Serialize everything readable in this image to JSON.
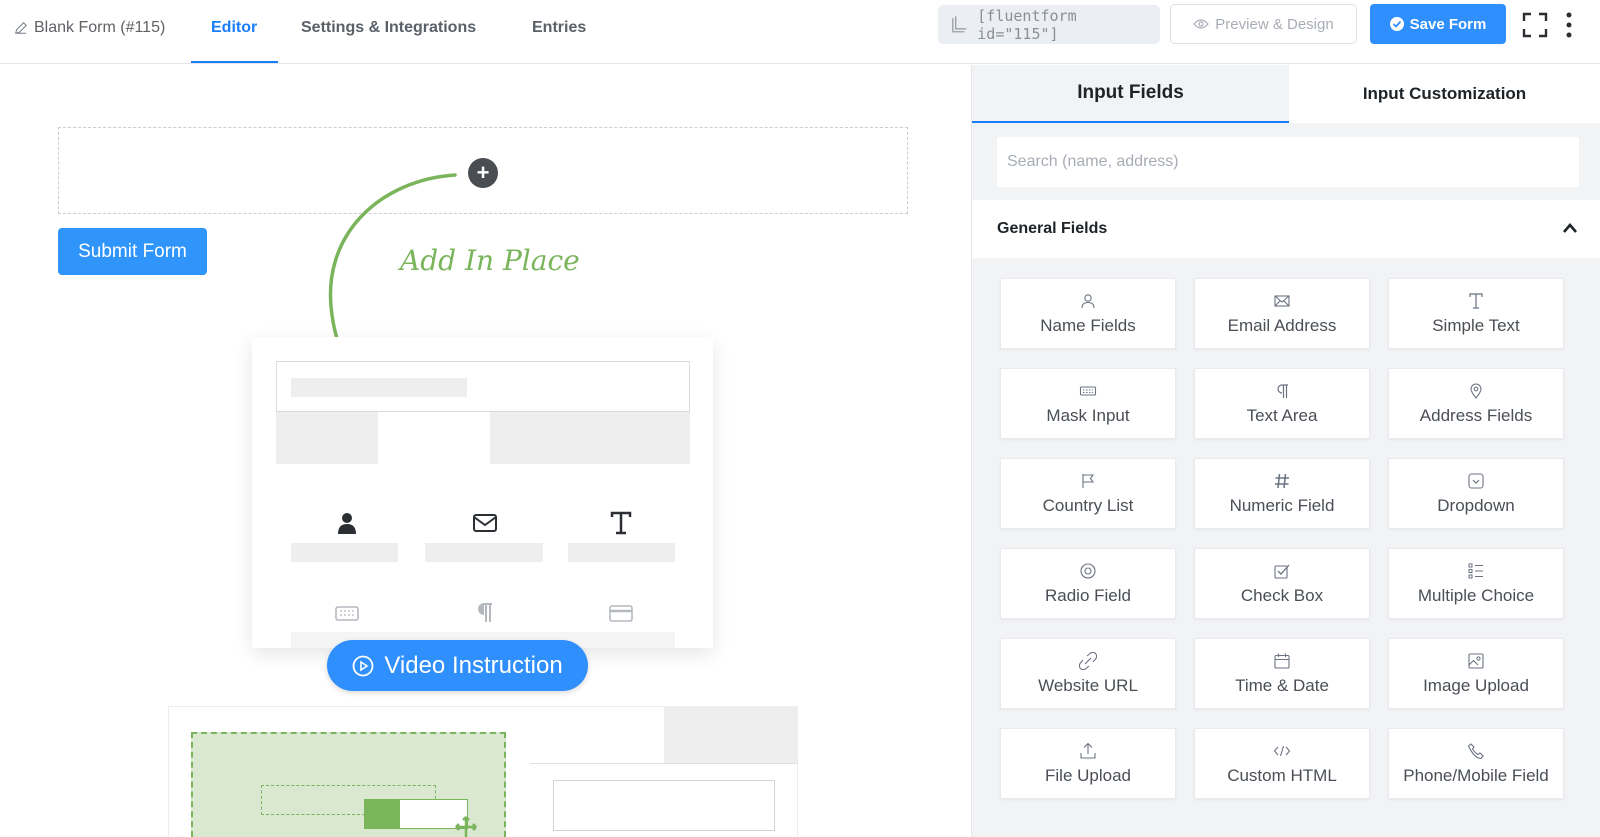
{
  "header": {
    "form_title": "Blank Form (#115)",
    "tabs": [
      {
        "label": "Editor",
        "active": true
      },
      {
        "label": "Settings & Integrations",
        "active": false
      },
      {
        "label": "Entries",
        "active": false
      }
    ],
    "shortcode": "[fluentform id=\"115\"]",
    "preview_label": "Preview & Design",
    "save_label": "Save Form",
    "accent_color": "#1a7efb"
  },
  "canvas": {
    "submit_label": "Submit Form",
    "add_in_place_label": "Add In Place",
    "video_label": "Video Instruction"
  },
  "panel": {
    "tabs": [
      {
        "label": "Input Fields",
        "active": true
      },
      {
        "label": "Input Customization",
        "active": false
      }
    ],
    "search_placeholder": "Search (name, address)",
    "section_title": "General Fields",
    "fields": [
      {
        "label": "Name Fields",
        "icon": "user-icon"
      },
      {
        "label": "Email Address",
        "icon": "envelope-icon"
      },
      {
        "label": "Simple Text",
        "icon": "text-icon"
      },
      {
        "label": "Mask Input",
        "icon": "keyboard-icon"
      },
      {
        "label": "Text Area",
        "icon": "paragraph-icon"
      },
      {
        "label": "Address Fields",
        "icon": "map-pin-icon"
      },
      {
        "label": "Country List",
        "icon": "flag-icon"
      },
      {
        "label": "Numeric Field",
        "icon": "hash-icon"
      },
      {
        "label": "Dropdown",
        "icon": "dropdown-icon"
      },
      {
        "label": "Radio Field",
        "icon": "radio-icon"
      },
      {
        "label": "Check Box",
        "icon": "checkbox-icon"
      },
      {
        "label": "Multiple Choice",
        "icon": "list-icon"
      },
      {
        "label": "Website URL",
        "icon": "link-icon"
      },
      {
        "label": "Time & Date",
        "icon": "calendar-icon"
      },
      {
        "label": "Image Upload",
        "icon": "image-icon"
      },
      {
        "label": "File Upload",
        "icon": "upload-icon"
      },
      {
        "label": "Custom HTML",
        "icon": "code-icon"
      },
      {
        "label": "Phone/Mobile Field",
        "icon": "phone-icon"
      }
    ]
  }
}
